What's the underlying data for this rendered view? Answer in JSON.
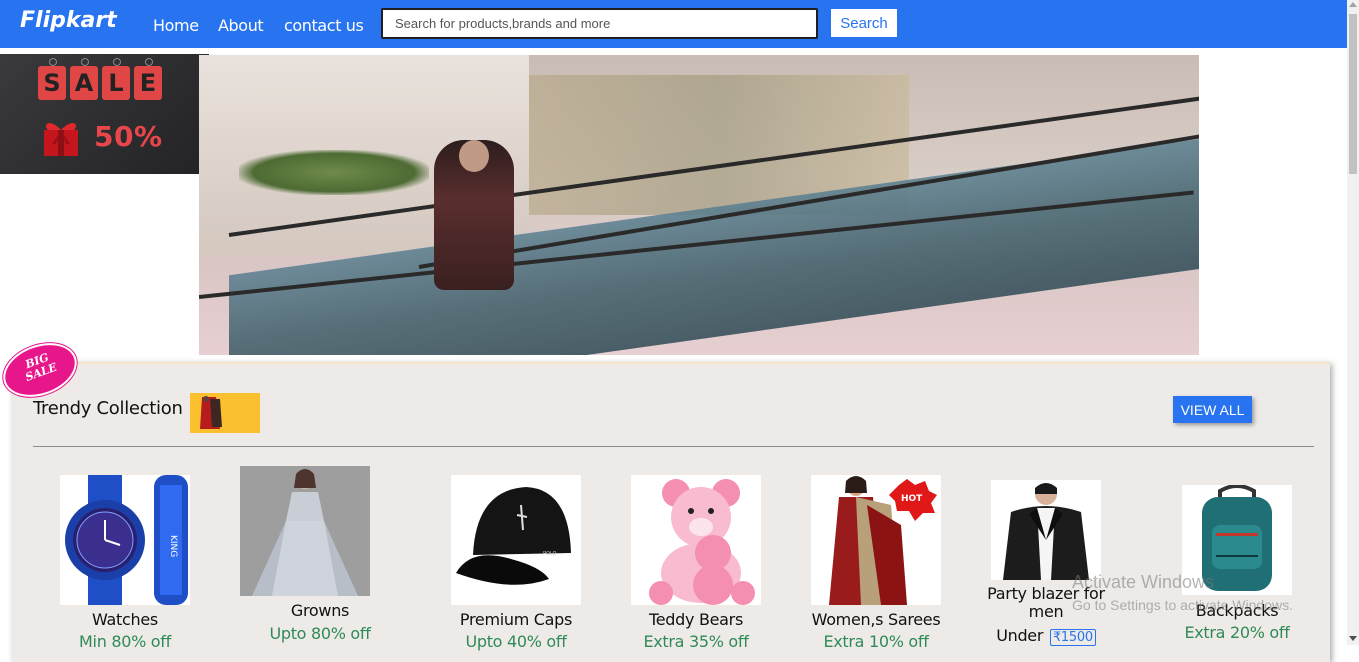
{
  "navbar": {
    "logo": "Flipkart",
    "links": [
      "Home",
      "About",
      "contact us"
    ],
    "search_placeholder": "Search for products,brands and more",
    "search_button": "Search",
    "color": "#2874f0"
  },
  "sale_banner": {
    "letters": [
      "S",
      "A",
      "L",
      "E"
    ],
    "percent": "50%"
  },
  "trendy": {
    "badge_line1": "BIG",
    "badge_line2": "SALE",
    "title": "Trendy Collection",
    "view_all": "VIEW ALL",
    "products": [
      {
        "name": "Watches",
        "offer": "Min 80% off",
        "icon": "watch-image"
      },
      {
        "name": "Growns",
        "offer": "Upto 80% off",
        "icon": "gown-image"
      },
      {
        "name": "Premium Caps",
        "offer": "Upto 40% off",
        "icon": "cap-image"
      },
      {
        "name": "Teddy Bears",
        "offer": "Extra 35% off",
        "icon": "teddy-bear-image"
      },
      {
        "name": "Women,s Sarees",
        "offer": "Extra 10% off",
        "icon": "saree-image",
        "hot_badge": "HOT"
      },
      {
        "name_line1": "Party blazer for",
        "name_line2": "men",
        "offer_prefix": "Under",
        "offer_price": "₹1500",
        "icon": "blazer-image"
      },
      {
        "name": "Backpacks",
        "offer": "Extra 20% off",
        "icon": "backpack-image"
      }
    ]
  },
  "watermark": {
    "title": "Activate Windows",
    "subtitle": "Go to Settings to activate Windows."
  }
}
